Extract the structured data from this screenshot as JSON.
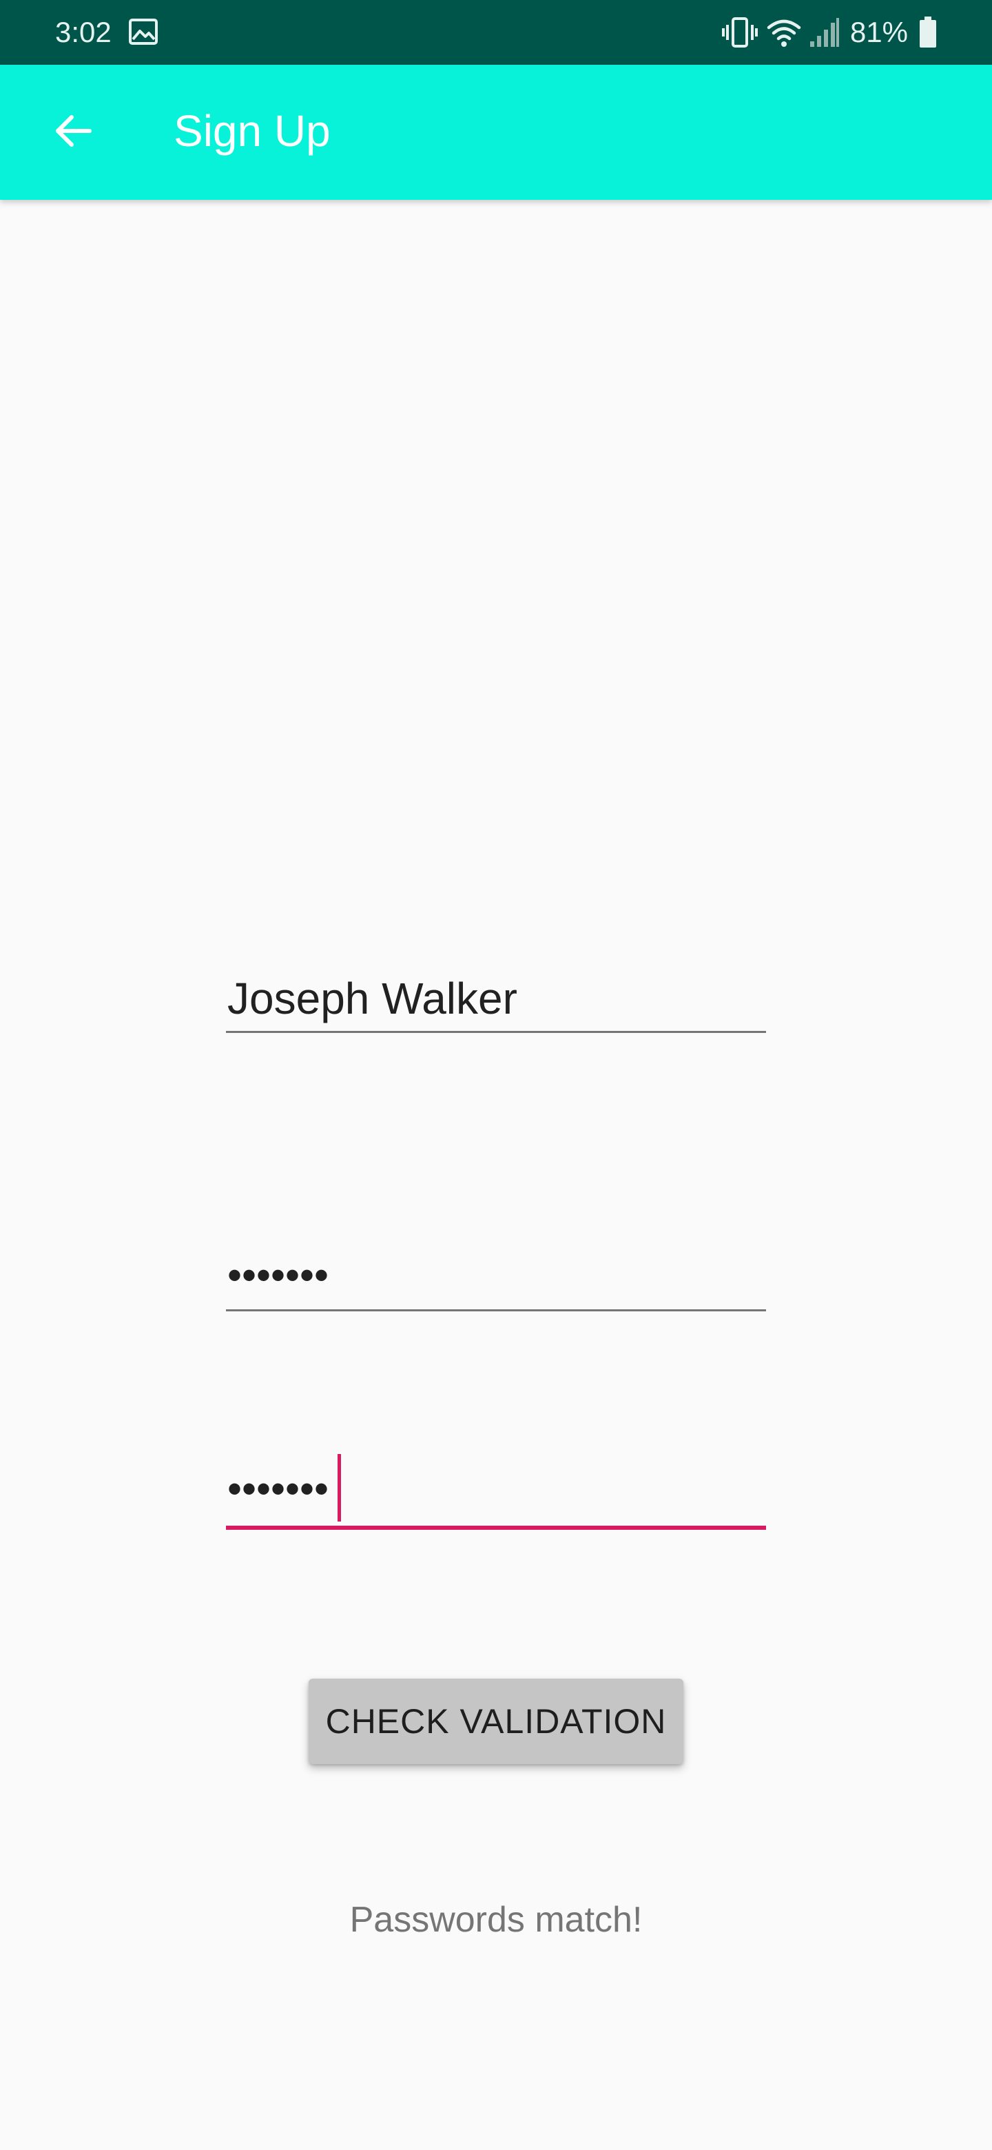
{
  "status_bar": {
    "time": "3:02",
    "battery_percent": "81%",
    "icons": [
      "image-icon",
      "vibrate-icon",
      "wifi-icon",
      "cell-signal-icon",
      "battery-icon"
    ],
    "background_color": "#00554a"
  },
  "app_bar": {
    "title": "Sign Up",
    "back_icon": "arrow-left-icon",
    "background_color": "#07f2d8"
  },
  "form": {
    "name_value": "Joseph Walker",
    "password_value": "•••••••",
    "confirm_password_value": "•••••••",
    "focus_color": "#d81b60"
  },
  "check_button": {
    "label": "CHECK VALIDATION"
  },
  "result": {
    "message": "Passwords match!"
  }
}
